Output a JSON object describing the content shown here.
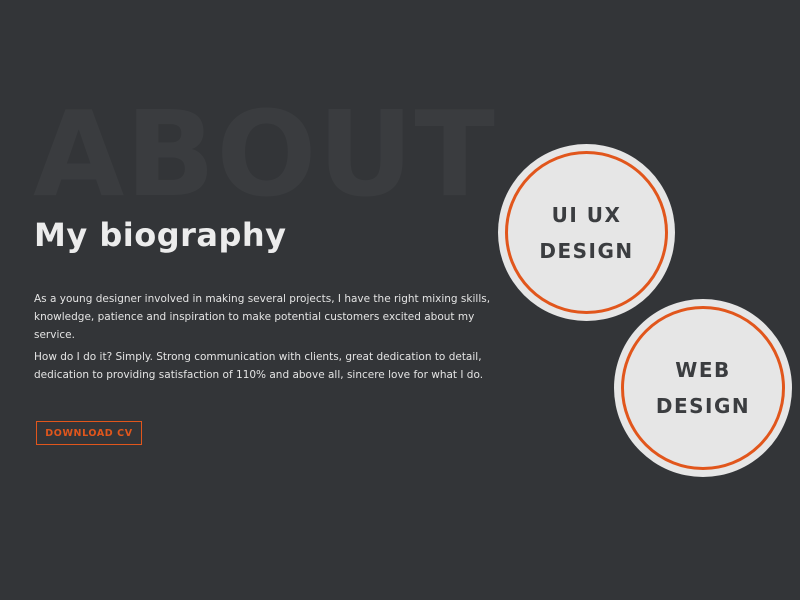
{
  "background_word": "ABOUT",
  "section_title": "My biography",
  "bio": {
    "paragraph_1": "As a young designer involved in making several projects, I have the right mixing skills, knowledge, patience and inspiration to make potential customers excited about my service.",
    "paragraph_2": "How do I do it? Simply. Strong communication with clients, great dedication to detail, dedication to providing satisfaction of 110% and above all, sincere love for what I do."
  },
  "download_button_label": "DOWNLOAD CV",
  "services": [
    {
      "label": "UI UX DESIGN"
    },
    {
      "label": "WEB DESIGN"
    }
  ],
  "colors": {
    "background": "#333538",
    "accent": "#e1561c",
    "circle_fill": "#e6e6e6",
    "text_light": "#ececec"
  }
}
